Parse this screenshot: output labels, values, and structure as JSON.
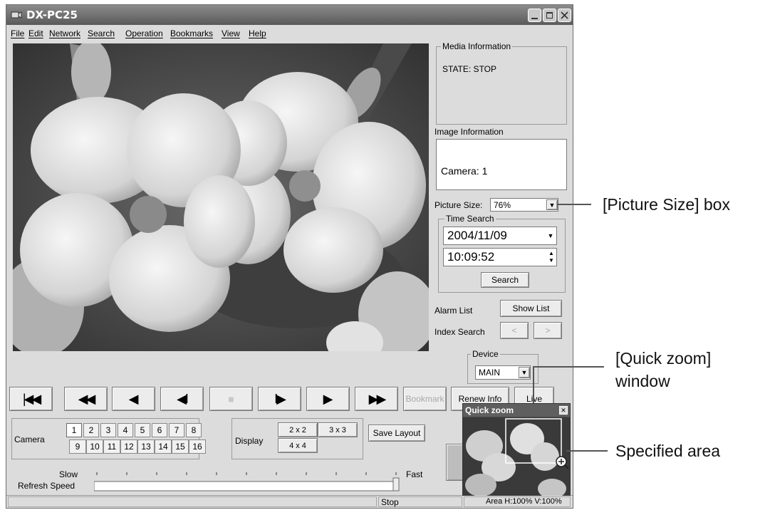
{
  "app": {
    "title": "DX-PC25"
  },
  "menu": [
    "File",
    "Edit",
    "Network",
    "Search",
    "Operation",
    "Bookmarks",
    "View",
    "Help"
  ],
  "media_info": {
    "legend": "Media Information",
    "state": "STATE: STOP"
  },
  "image_info": {
    "label": "Image Information",
    "camera": "Camera: 1"
  },
  "picture_size": {
    "label": "Picture Size:",
    "value": "76%"
  },
  "time_search": {
    "legend": "Time Search",
    "date": "2004/11/09",
    "time": "10:09:52",
    "button": "Search"
  },
  "alarm_list": {
    "label": "Alarm List",
    "button": "Show List"
  },
  "index_search": {
    "label": "Index Search",
    "prev": "<",
    "next": ">"
  },
  "device": {
    "legend": "Device",
    "value": "MAIN"
  },
  "transport": {
    "first": "|◀◀",
    "rew": "◀◀",
    "back": "◀",
    "step_back": "◀I",
    "stop": "■",
    "step_fwd": "I▶",
    "play": "▶",
    "ff": "▶▶",
    "bookmark": "Bookmark",
    "renew": "Renew Info",
    "live": "Live"
  },
  "camera_panel": {
    "label": "Camera",
    "numbers": [
      "1",
      "2",
      "3",
      "4",
      "5",
      "6",
      "7",
      "8",
      "9",
      "10",
      "11",
      "12",
      "13",
      "14",
      "15",
      "16"
    ],
    "selected": "1"
  },
  "display_panel": {
    "label": "Display",
    "options": [
      "2 x 2",
      "3 x 3",
      "4 x 4"
    ]
  },
  "save_layout": "Save Layout",
  "refresh": {
    "label": "Refresh Speed",
    "slow": "Slow",
    "fast": "Fast"
  },
  "statusbar": {
    "state": "Stop",
    "area": "Area H:100% V:100%"
  },
  "quick_zoom": {
    "title": "Quick zoom",
    "close": "✕"
  },
  "callouts": {
    "picture_size": "[Picture Size] box",
    "quick_zoom_1": "[Quick zoom]",
    "quick_zoom_2": "window",
    "specified_area": "Specified area"
  }
}
